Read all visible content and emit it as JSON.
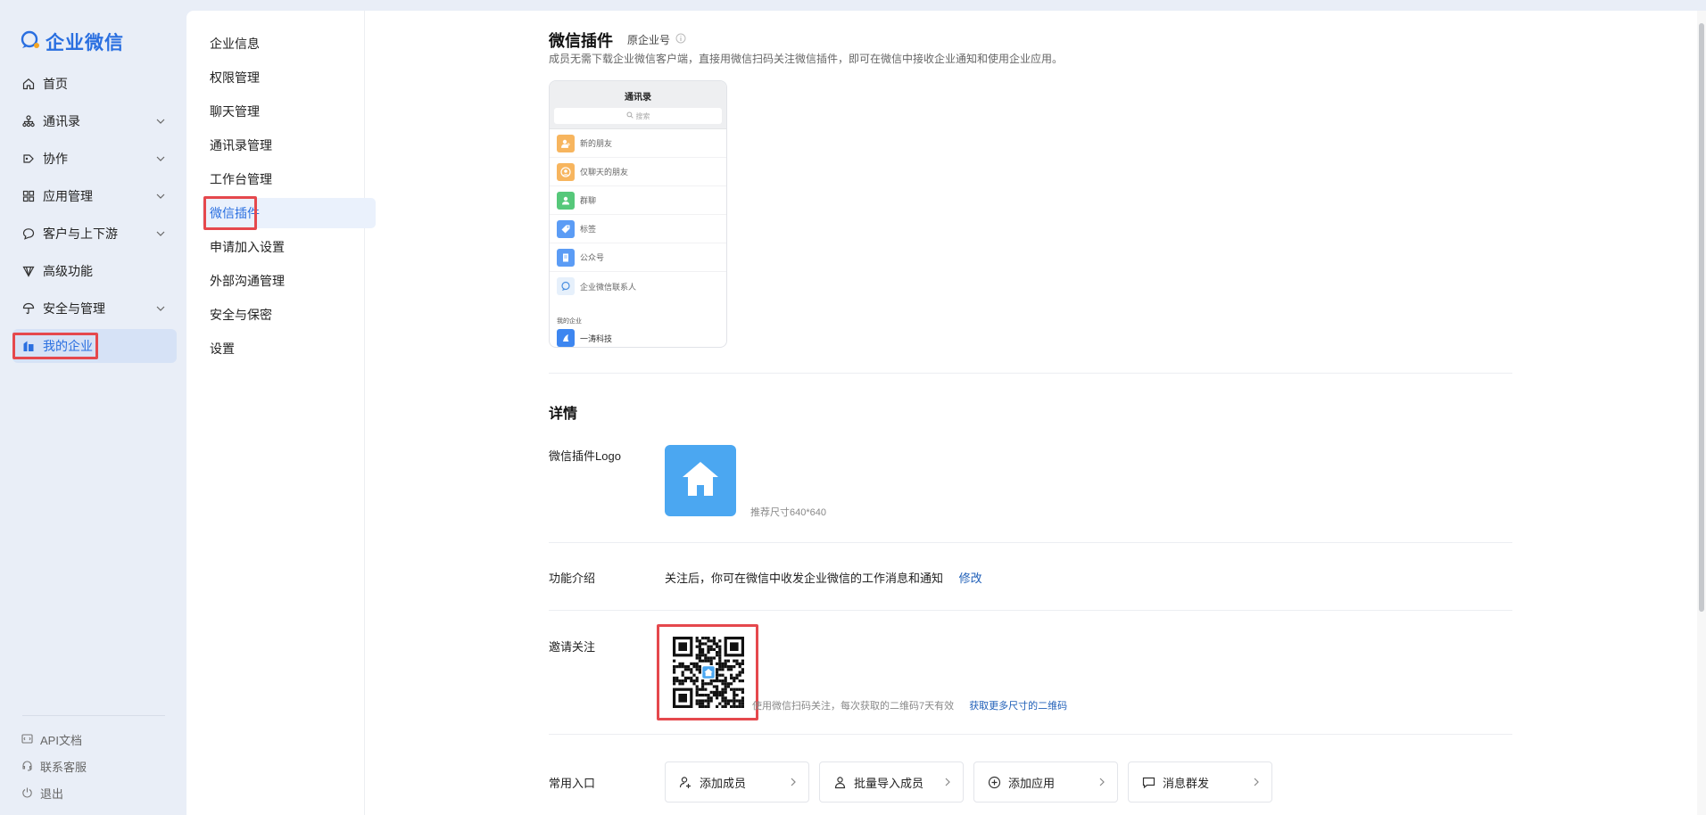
{
  "app": {
    "name": "企业微信"
  },
  "sidebar": {
    "items": [
      {
        "label": "首页",
        "icon": "home-icon"
      },
      {
        "label": "通讯录",
        "icon": "org-chart-icon"
      },
      {
        "label": "协作",
        "icon": "collaboration-icon"
      },
      {
        "label": "应用管理",
        "icon": "apps-grid-icon"
      },
      {
        "label": "客户与上下游",
        "icon": "chat-bubble-icon"
      },
      {
        "label": "高级功能",
        "icon": "diamond-icon"
      },
      {
        "label": "安全与管理",
        "icon": "umbrella-icon"
      },
      {
        "label": "我的企业",
        "icon": "building-icon"
      }
    ],
    "footer": [
      {
        "label": "API文档",
        "icon": "api-doc-icon"
      },
      {
        "label": "联系客服",
        "icon": "headset-icon"
      },
      {
        "label": "退出",
        "icon": "power-icon"
      }
    ]
  },
  "subnav": {
    "items": [
      "企业信息",
      "权限管理",
      "聊天管理",
      "通讯录管理",
      "工作台管理",
      "微信插件",
      "申请加入设置",
      "外部沟通管理",
      "安全与保密",
      "设置"
    ]
  },
  "content": {
    "title": "微信插件",
    "corp_tag": "原企业号",
    "description": "成员无需下载企业微信客户端，直接用微信扫码关注微信插件，即可在微信中接收企业通知和使用企业应用。",
    "phone": {
      "title": "通讯录",
      "search_placeholder": "搜索",
      "rows": [
        "新的朋友",
        "仅聊天的朋友",
        "群聊",
        "标签",
        "公众号",
        "企业微信联系人"
      ],
      "my_corp_label": "我的企业",
      "corp_name": "一涛科技"
    },
    "details_title": "详情",
    "logo_label": "微信插件Logo",
    "logo_hint": "推荐尺寸640*640",
    "intro_label": "功能介绍",
    "intro_text": "关注后，你可在微信中收发企业微信的工作消息和通知",
    "intro_edit": "修改",
    "invite_label": "邀请关注",
    "invite_hint": "使用微信扫码关注，每次获取的二维码7天有效",
    "invite_link": "获取更多尺寸的二维码",
    "entries_label": "常用入口",
    "entries": [
      {
        "label": "添加成员",
        "icon": "add-user-icon"
      },
      {
        "label": "批量导入成员",
        "icon": "users-icon"
      },
      {
        "label": "添加应用",
        "icon": "plus-circle-icon"
      },
      {
        "label": "消息群发",
        "icon": "message-icon"
      }
    ]
  },
  "colors": {
    "accent": "#2a6fe0",
    "highlight": "#e5484d",
    "logo_bg": "#4ba7f1"
  }
}
